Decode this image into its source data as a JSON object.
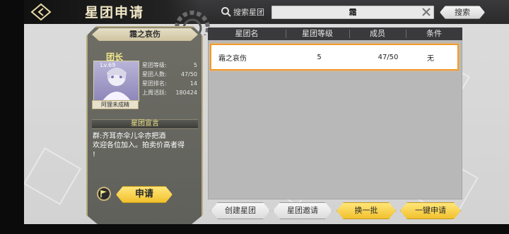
{
  "header": {
    "title": "星团申请",
    "search_label": "搜索星团",
    "search_value": "霜",
    "search_button": "搜索"
  },
  "card": {
    "guild_name": "霜之哀伤",
    "leader_label": "团长",
    "avatar_level": "Lv.69",
    "leader_name": "阿狸未成精",
    "stats": [
      {
        "label": "星团等级:",
        "value": "5"
      },
      {
        "label": "星团人数:",
        "value": "47/50"
      },
      {
        "label": "星团排名:",
        "value": "14"
      },
      {
        "label": "上周活跃:",
        "value": "180424"
      }
    ],
    "declaration_title": "星团宣言",
    "declaration_text": "群:齐耳亦伞儿伞亦把酒\n欢迎各位加入。拍卖价高者得\n!",
    "apply_button": "申请"
  },
  "table": {
    "headers": [
      "星团名",
      "星团等级",
      "成员",
      "条件"
    ],
    "rows": [
      {
        "name": "霜之哀伤",
        "level": "5",
        "members": "47/50",
        "condition": "无"
      }
    ]
  },
  "buttons": {
    "create": "创建星团",
    "invite": "星团邀请",
    "refresh": "换一批",
    "apply_all": "一键申请"
  },
  "colors": {
    "accent_yellow": "#f2c12d",
    "selected_border": "#f29a2b",
    "header_dark": "#3a3a3c"
  }
}
